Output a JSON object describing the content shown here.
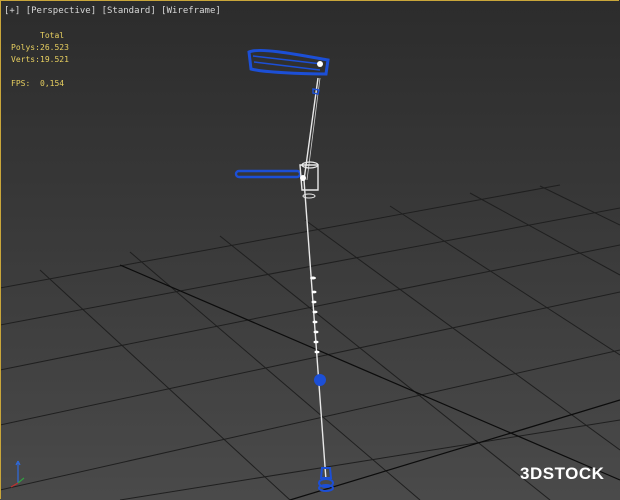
{
  "viewport": {
    "menus": [
      "[+]",
      "[Perspective]",
      "[Standard]",
      "[Wireframe]"
    ]
  },
  "stats": {
    "header": "Total",
    "polys_label": "Polys:",
    "polys_value": "26.523",
    "verts_label": "Verts:",
    "verts_value": "19.521",
    "fps_label": "FPS:",
    "fps_value": "0,154"
  },
  "watermark": "3DSTOCK",
  "colors": {
    "selection_blue": "#1c4fd6",
    "wire_white": "#e8e8e8",
    "stats_yellow": "#e8d060",
    "grid": "#1e1e1e",
    "viewport_border": "#c9a63a"
  },
  "icons": [
    "axis-gizmo-icon"
  ]
}
